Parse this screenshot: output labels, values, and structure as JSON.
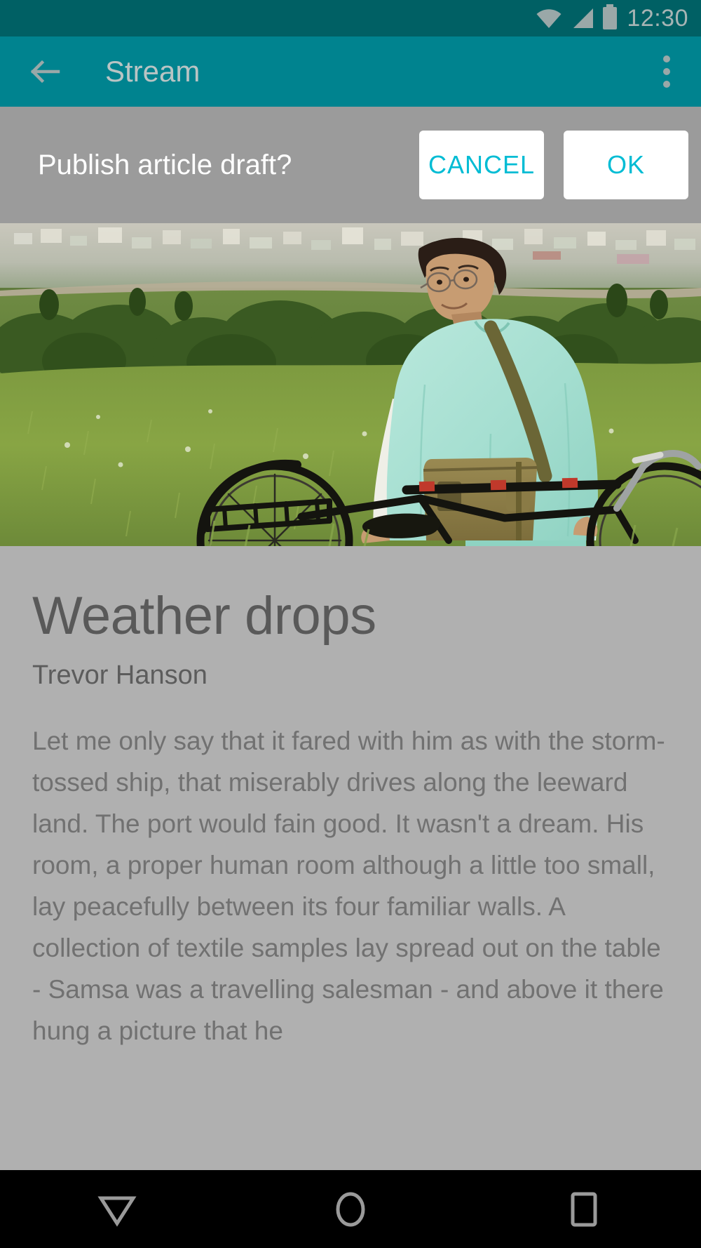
{
  "status_bar": {
    "time": "12:30",
    "icons": [
      "wifi-icon",
      "cell-signal-icon",
      "battery-icon"
    ],
    "background": "#006064",
    "foreground": "#9aa8a8"
  },
  "toolbar": {
    "title": "Stream",
    "back_icon": "back-arrow-icon",
    "overflow_icon": "overflow-menu-icon",
    "background": "#00838f"
  },
  "dialog": {
    "message": "Publish article draft?",
    "cancel_label": "CANCEL",
    "ok_label": "OK",
    "scrim_color": "#9b9b9b",
    "button_text_color": "#00bcd4",
    "button_background": "#ffffff"
  },
  "hero": {
    "alt": "Man in mint scrubs standing with a bicycle in a green field",
    "name": "hero-photo"
  },
  "article": {
    "title": "Weather drops",
    "author": "Trevor Hanson",
    "body": "Let me only say that it fared with him as with the storm-tossed ship, that miserably drives along the leeward land. The port would fain good. It wasn't a dream. His room, a proper human room although a little too small, lay peacefully between its four familiar walls. A collection of textile samples lay spread out on the table - Samsa was a travelling salesman - and above it there hung a picture that he",
    "title_color": "#1c1c1c",
    "body_color": "#5a5a5a"
  },
  "nav_bar": {
    "background": "#000000",
    "items": [
      {
        "name": "back-nav-icon",
        "label": "Back"
      },
      {
        "name": "home-nav-icon",
        "label": "Home"
      },
      {
        "name": "recents-nav-icon",
        "label": "Recents"
      }
    ]
  }
}
